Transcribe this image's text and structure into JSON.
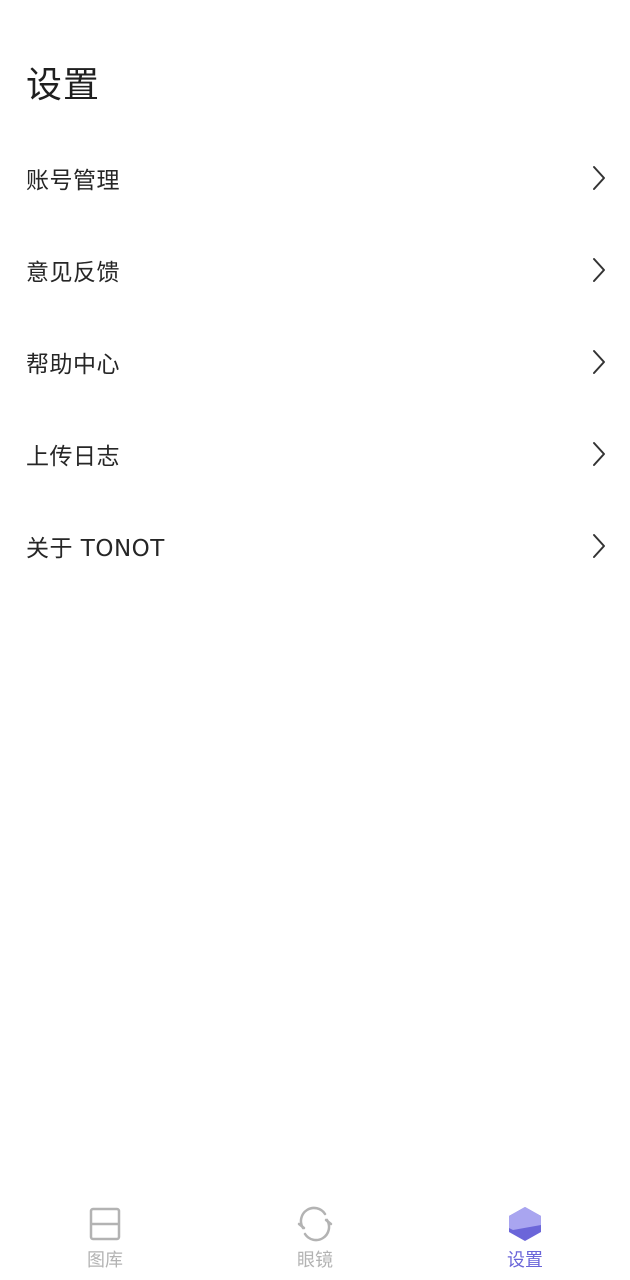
{
  "header": {
    "title": "设置"
  },
  "menu": {
    "items": [
      {
        "label": "账号管理",
        "icon": "chevron-right-icon"
      },
      {
        "label": "意见反馈",
        "icon": "chevron-right-icon"
      },
      {
        "label": "帮助中心",
        "icon": "chevron-right-icon"
      },
      {
        "label": "上传日志",
        "icon": "chevron-right-icon"
      },
      {
        "label": "关于 TONOT",
        "icon": "chevron-right-icon"
      }
    ]
  },
  "tabbar": {
    "tabs": [
      {
        "label": "图库",
        "icon": "gallery-icon",
        "active": false
      },
      {
        "label": "眼镜",
        "icon": "glasses-sync-icon",
        "active": false
      },
      {
        "label": "设置",
        "icon": "settings-cube-icon",
        "active": true
      }
    ]
  },
  "colors": {
    "accent": "#6b66d9",
    "accent_light": "#a9a5f0",
    "inactive": "#b3b3b3",
    "text": "#262626",
    "background": "#ffffff"
  }
}
